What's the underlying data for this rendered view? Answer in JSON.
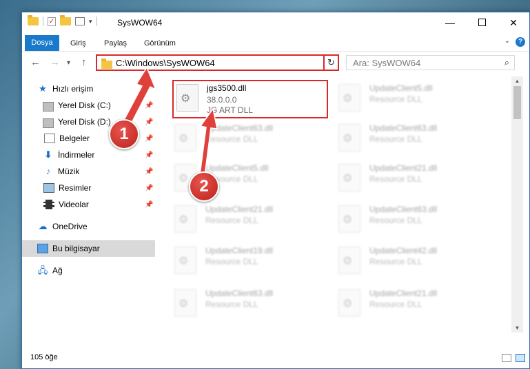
{
  "window": {
    "title": "SysWOW64",
    "controls": {
      "minimize": "—",
      "close": "✕"
    }
  },
  "ribbon": {
    "tabs": [
      "Dosya",
      "Giriş",
      "Paylaş",
      "Görünüm"
    ],
    "help": "?"
  },
  "nav": {
    "back": "←",
    "forward": "→",
    "dropdown": "▾",
    "up": "↑",
    "address": "C:\\Windows\\SysWOW64",
    "refresh": "↻",
    "search_placeholder": "Ara: SysWOW64",
    "search_icon": "⌕"
  },
  "sidebar": {
    "items": [
      {
        "label": "Hızlı erişim",
        "icon": "star-icon",
        "pinned": false
      },
      {
        "label": "Yerel Disk (C:)",
        "icon": "disk-icon",
        "pinned": true
      },
      {
        "label": "Yerel Disk (D:)",
        "icon": "disk-icon",
        "pinned": true
      },
      {
        "label": "Belgeler",
        "icon": "document-icon",
        "pinned": true
      },
      {
        "label": "İndirmeler",
        "icon": "download-icon",
        "pinned": true
      },
      {
        "label": "Müzik",
        "icon": "music-icon",
        "pinned": true
      },
      {
        "label": "Resimler",
        "icon": "pictures-icon",
        "pinned": true
      },
      {
        "label": "Videolar",
        "icon": "videos-icon",
        "pinned": true
      },
      {
        "label": "OneDrive",
        "icon": "cloud-icon",
        "pinned": false
      },
      {
        "label": "Bu bilgisayar",
        "icon": "computer-icon",
        "pinned": false,
        "selected": true
      },
      {
        "label": "Ağ",
        "icon": "network-icon",
        "pinned": false
      }
    ]
  },
  "files": [
    {
      "name": "jgs3500.dll",
      "line2": "38.0.0.0",
      "line3": "JG ART DLL",
      "highlighted": true
    },
    {
      "name": "UpdateClient5.dll",
      "line2": "Resource DLL"
    },
    {
      "name": "UpdateClient63.dll",
      "line2": "Resource DLL"
    },
    {
      "name": "UpdateClient63.dll",
      "line2": "Resource DLL"
    },
    {
      "name": "UpdateClient5.dll",
      "line2": "Resource DLL"
    },
    {
      "name": "UpdateClient21.dll",
      "line2": "Resource DLL"
    },
    {
      "name": "UpdateClient21.dll",
      "line2": "Resource DLL"
    },
    {
      "name": "UpdateClient63.dll",
      "line2": "Resource DLL"
    },
    {
      "name": "UpdateClient19.dll",
      "line2": "Resource DLL"
    },
    {
      "name": "UpdateClient42.dll",
      "line2": "Resource DLL"
    },
    {
      "name": "UpdateClient63.dll",
      "line2": "Resource DLL"
    },
    {
      "name": "UpdateClient21.dll",
      "line2": "Resource DLL"
    }
  ],
  "status": {
    "count": "105 öğe"
  },
  "annotations": {
    "badge1": "1",
    "badge2": "2"
  },
  "colors": {
    "accent": "#1979ca",
    "highlight": "#d9282a",
    "badge": "#c9302a"
  }
}
